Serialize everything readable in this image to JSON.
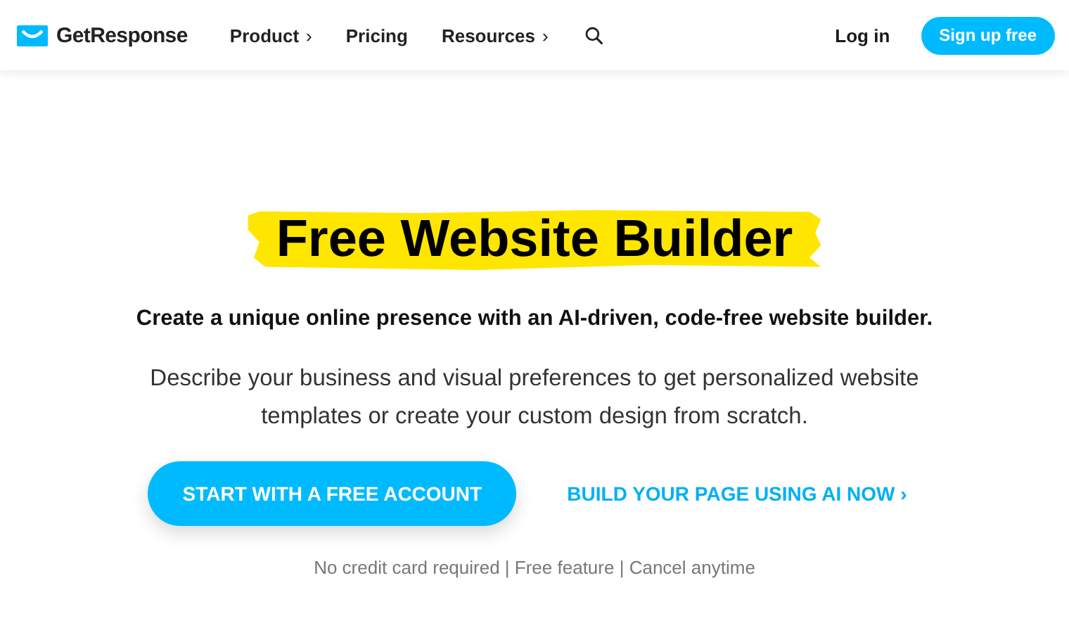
{
  "header": {
    "logo": "GetResponse",
    "nav": [
      {
        "label": "Product",
        "chevron": "›"
      },
      {
        "label": "Pricing"
      },
      {
        "label": "Resources",
        "chevron": "›"
      }
    ],
    "login": "Log in",
    "signup": "Sign up free"
  },
  "hero": {
    "title": "Free Website Builder",
    "subtitle": "Create a unique online presence with an AI-driven, code-free website builder.",
    "description": "Describe your business and visual preferences to get personalized website templates or create your custom design from scratch.",
    "primary_button": "START WITH A FREE ACCOUNT",
    "secondary_link": "BUILD YOUR PAGE USING AI NOW ›",
    "note": "No credit card required | Free feature | Cancel anytime"
  }
}
